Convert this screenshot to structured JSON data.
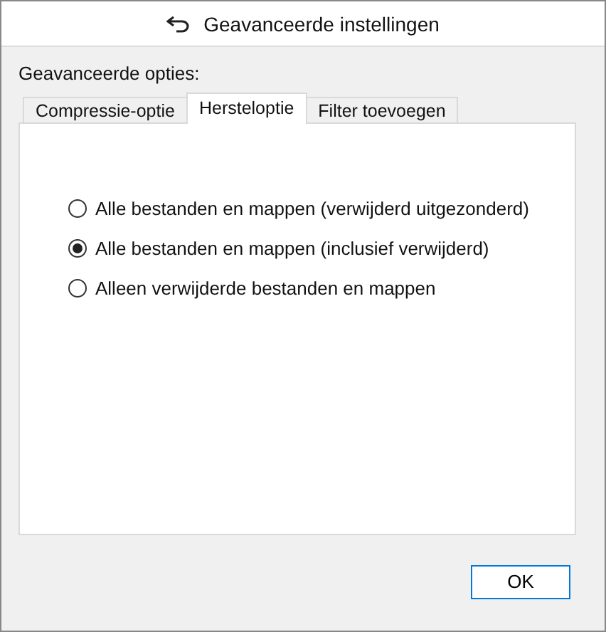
{
  "window": {
    "title": "Geavanceerde instellingen"
  },
  "section_label": "Geavanceerde opties:",
  "tabs": [
    {
      "label": "Compressie-optie",
      "selected": false
    },
    {
      "label": "Hersteloptie",
      "selected": true
    },
    {
      "label": "Filter toevoegen",
      "selected": false
    }
  ],
  "options": [
    {
      "label": "Alle bestanden en mappen (verwijderd uitgezonderd)",
      "selected": false
    },
    {
      "label": "Alle bestanden en mappen (inclusief verwijderd)",
      "selected": true
    },
    {
      "label": "Alleen verwijderde bestanden en mappen",
      "selected": false
    }
  ],
  "buttons": [
    "OK"
  ]
}
